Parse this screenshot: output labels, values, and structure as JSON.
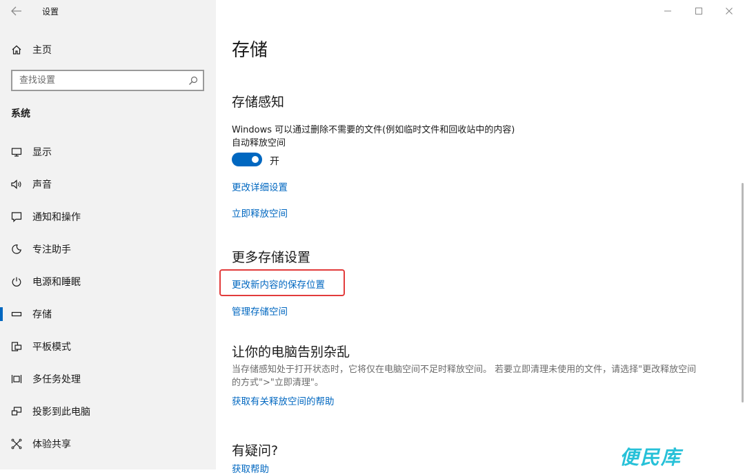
{
  "window": {
    "title": "设置",
    "controls": {
      "minimize": "—",
      "maximize": "☐",
      "close": "✕"
    }
  },
  "sidebar": {
    "home_label": "主页",
    "search_placeholder": "查找设置",
    "section_label": "系统",
    "items": [
      {
        "label": "显示",
        "icon": "display-icon"
      },
      {
        "label": "声音",
        "icon": "speaker-icon"
      },
      {
        "label": "通知和操作",
        "icon": "notification-icon"
      },
      {
        "label": "专注助手",
        "icon": "moon-icon"
      },
      {
        "label": "电源和睡眠",
        "icon": "power-icon"
      },
      {
        "label": "存储",
        "icon": "storage-icon",
        "active": true
      },
      {
        "label": "平板模式",
        "icon": "tablet-icon"
      },
      {
        "label": "多任务处理",
        "icon": "multitask-icon"
      },
      {
        "label": "投影到此电脑",
        "icon": "project-icon"
      },
      {
        "label": "体验共享",
        "icon": "share-icon"
      }
    ]
  },
  "main": {
    "page_title": "存储",
    "storage_sense": {
      "heading": "存储感知",
      "description": "Windows 可以通过删除不需要的文件(例如临时文件和回收站中的内容)",
      "description2": "自动释放空间",
      "toggle_state": "开",
      "toggle_on": true,
      "link_change_settings": "更改详细设置",
      "link_free_now": "立即释放空间"
    },
    "more_storage": {
      "heading": "更多存储设置",
      "link_change_location": "更改新内容的保存位置",
      "link_manage_spaces": "管理存储空间"
    },
    "declutter": {
      "heading": "让你的电脑告别杂乱",
      "text_line1": "当存储感知处于打开状态时，它将仅在电脑空间不足时释放空间。 若要立即清理未使用的文件，请选择\"更改释放空间",
      "text_line2": "的方式\">\"立即清理\"。",
      "link_help": "获取有关释放空间的帮助"
    },
    "questions": {
      "heading": "有疑问?",
      "link_get_help": "获取帮助"
    }
  },
  "colors": {
    "accent": "#0067c0",
    "highlight_border": "#e23b3b",
    "watermark": "#27c1d8"
  },
  "watermark_text": "便民库"
}
